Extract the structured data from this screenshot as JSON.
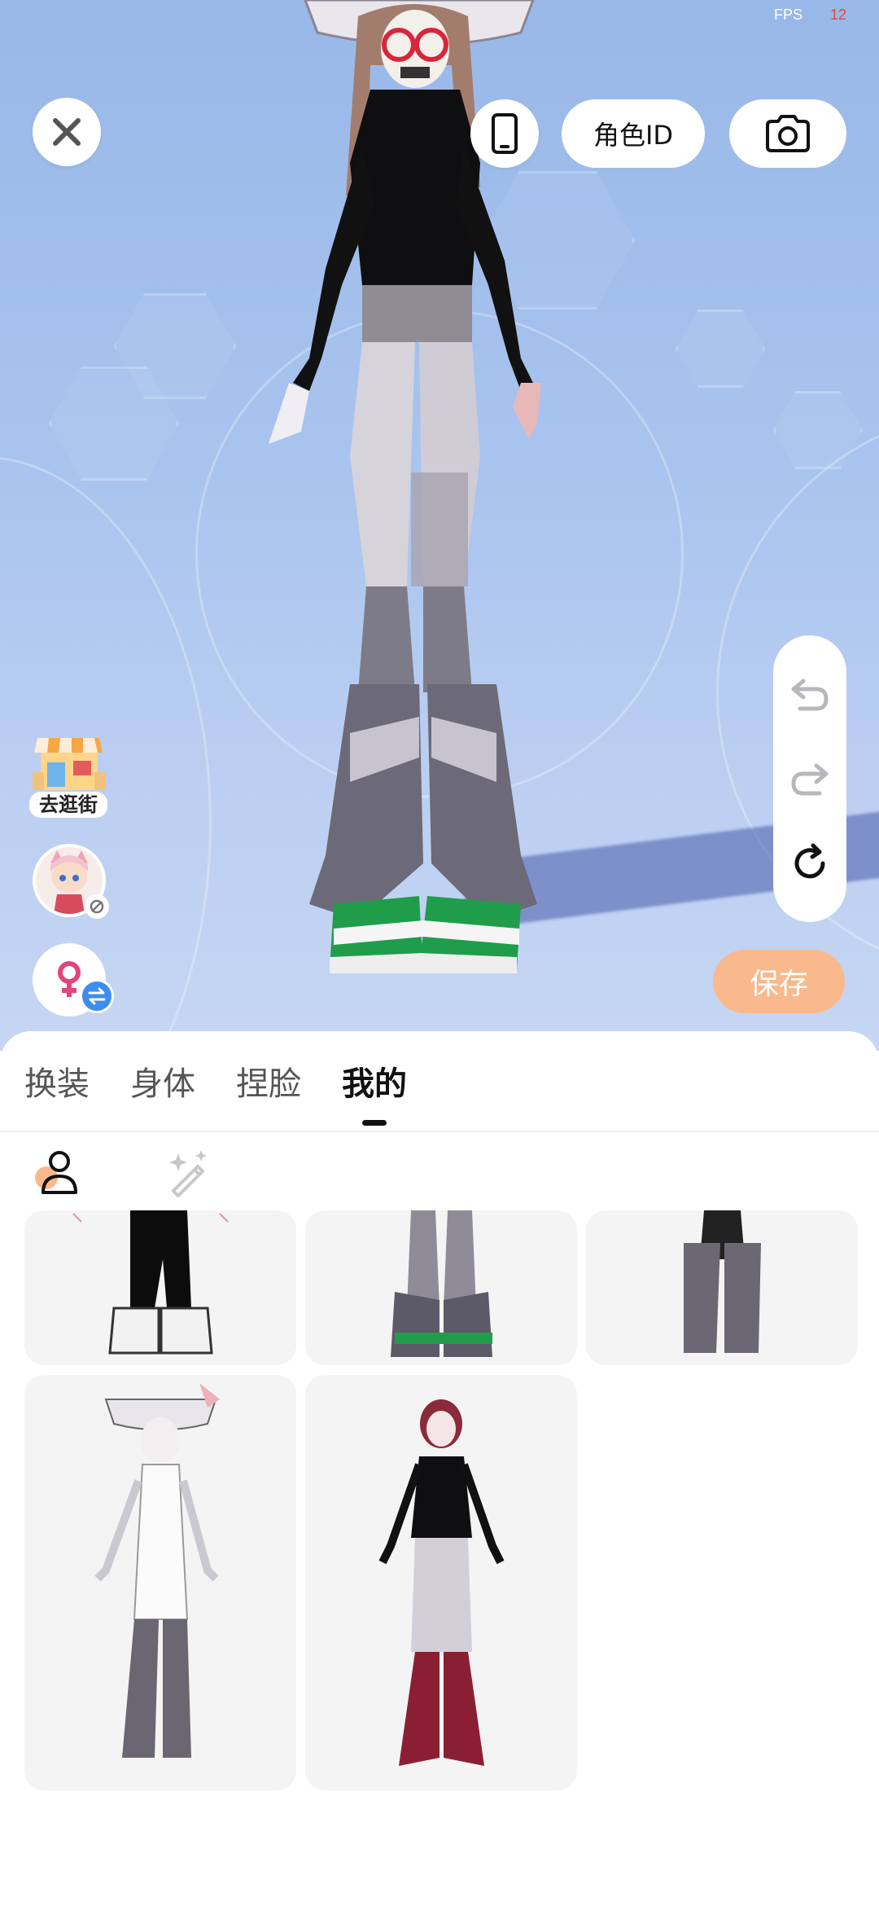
{
  "status": {
    "fps_label": "FPS",
    "fps_value": "12"
  },
  "top_bar": {
    "close_icon": "close-icon",
    "device_icon": "phone-frame-icon",
    "role_id_label": "角色ID",
    "camera_icon": "camera-icon"
  },
  "history_toolbar": {
    "undo_icon": "undo-icon",
    "redo_icon": "redo-icon",
    "reset_icon": "reset-rotate-icon"
  },
  "side": {
    "shop_label": "去逛街",
    "avatar_icon": "avatar-icon",
    "gender_icon": "female-icon",
    "swap_icon": "swap-icon"
  },
  "save_label": "保存",
  "tabs": [
    {
      "label": "换装",
      "active": false
    },
    {
      "label": "身体",
      "active": false
    },
    {
      "label": "捏脸",
      "active": false
    },
    {
      "label": "我的",
      "active": true
    }
  ],
  "subtabs": [
    {
      "icon": "person-icon",
      "active": true
    },
    {
      "icon": "magic-wand-icon",
      "active": false
    }
  ],
  "saved_looks": [
    {
      "id": 1,
      "theme": "black-pants-white-shoes"
    },
    {
      "id": 2,
      "theme": "grey-boots-green-shoes"
    },
    {
      "id": 3,
      "theme": "dark-grey-pants"
    },
    {
      "id": 4,
      "theme": "pirate-hat-white-dress"
    },
    {
      "id": 5,
      "theme": "red-hair-red-boots"
    }
  ],
  "colors": {
    "accent_save": "#f9b98c",
    "swap_badge": "#3d8cf0",
    "fps_value": "#e8463c",
    "stage_bg": "#a9c4ee"
  }
}
